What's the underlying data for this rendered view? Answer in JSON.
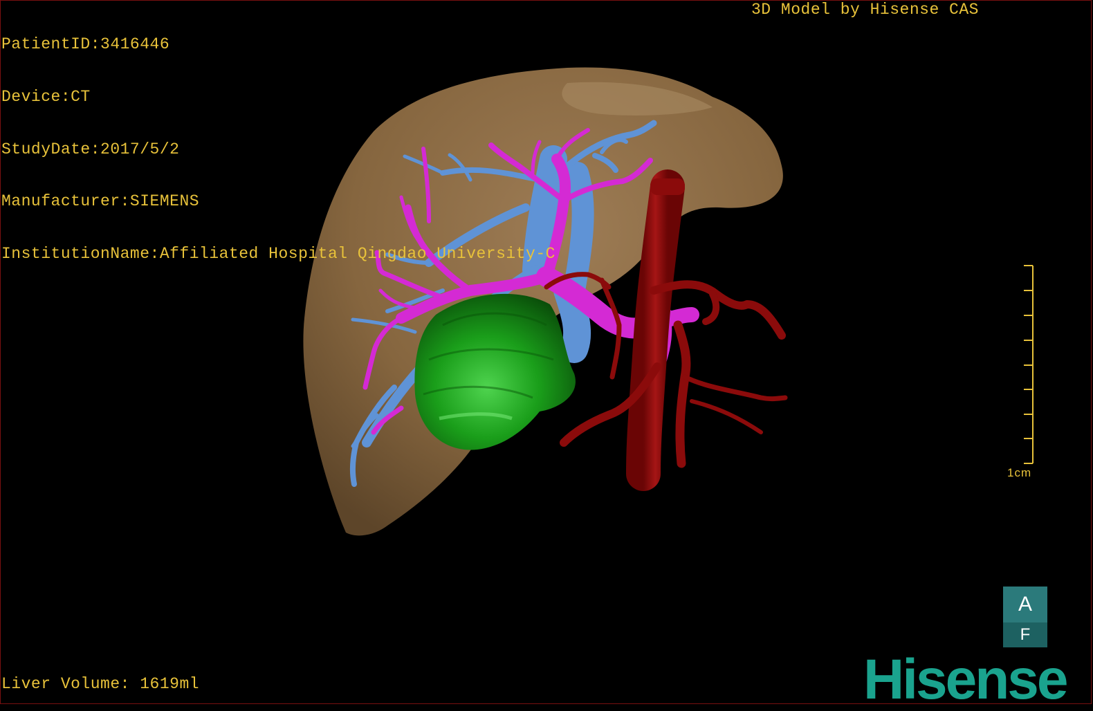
{
  "dicom_info": {
    "patient_id": "PatientID:3416446",
    "device": "Device:CT",
    "study_date": "StudyDate:2017/5/2",
    "manufacturer": "Manufacturer:SIEMENS",
    "institution": "InstitutionName:Affiliated Hospital Qingdao University-C"
  },
  "model_credit": "3D Model by Hisense CAS",
  "liver_volume": "Liver Volume: 1619ml",
  "scale": {
    "label": "1cm"
  },
  "orientation_cube": {
    "top_face": "A",
    "front_face": "F"
  },
  "brand": "Hisense",
  "colors": {
    "overlay_text": "#e8c23a",
    "liver": "#8a6a45",
    "portal_vein": "#d42ad4",
    "hepatic_vein": "#5f93d6",
    "artery": "#8b0b0b",
    "tumor": "#159b15",
    "brand": "#1aa38e",
    "cube": "#2b7a7b"
  },
  "structures": [
    "liver",
    "hepatic-vein",
    "portal-vein",
    "hepatic-artery",
    "tumor"
  ]
}
